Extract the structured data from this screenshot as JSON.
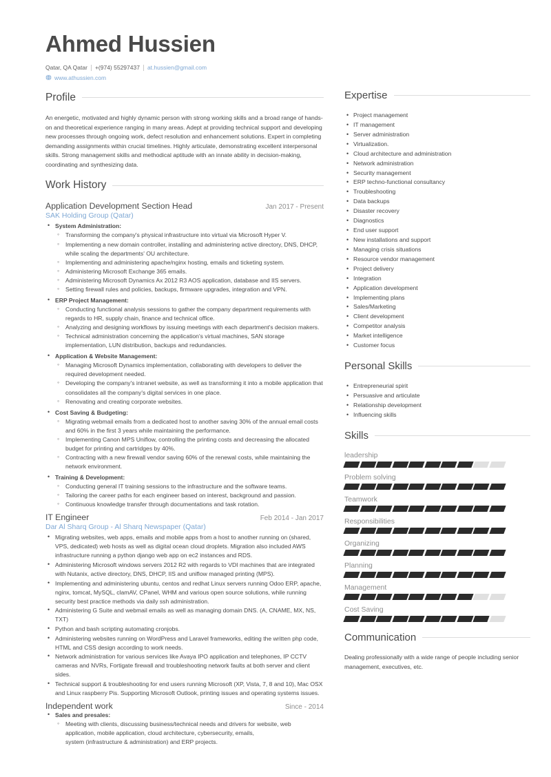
{
  "header": {
    "name": "Ahmed Hussien",
    "location": "Qatar, QA Qatar",
    "phone": "+(974) 55297437",
    "email": "at.hussien@gmail.com",
    "website": "www.athussien.com",
    "globe_icon": "globe-icon"
  },
  "sections": {
    "profile": "Profile",
    "work_history": "Work History",
    "expertise": "Expertise",
    "personal_skills": "Personal Skills",
    "skills": "Skills",
    "communication": "Communication"
  },
  "profile": {
    "text": "An energetic, motivated and highly dynamic person with strong working skills and a broad range of hands-on and theoretical experience ranging in many areas. Adept at providing technical support and developing new processes through ongoing work, defect resolution and enhancement solutions. Expert in completing demanding assignments within crucial timelines. Highly articulate, demonstrating excellent interpersonal skills. Strong management skills and methodical aptitude with an innate ability in decision-making, coordinating and synthesizing data."
  },
  "jobs": [
    {
      "title": "Application Development Section Head",
      "date": "Jan 2017 - Present",
      "company": "SAK Holding Group (Qatar)",
      "groups": [
        {
          "heading": "System Administration:",
          "items": [
            "Transforming the company's physical infrastructure into virtual via Microsoft Hyper V.",
            "Implementing a new domain controller, installing and administering active directory, DNS, DHCP, while  scaling the departments' OU architecture.",
            "Implementing and administering apache/nginx hosting, emails and ticketing system.",
            "Administering Microsoft Exchange 365 emails.",
            "Administering Microsoft Dynamics Ax 2012 R3 AOS application, database and IIS servers.",
            "Setting firewall rules and policies, backups, firmware upgrades, integration and VPN."
          ]
        },
        {
          "heading": "ERP Project Management:",
          "items": [
            "Conducting functional analysis sessions to gather the company department requirements with regards to HR, supply chain, finance and technical office.",
            "Analyzing and designing workflows by issuing meetings with each department's decision makers.",
            "Technical administration concerning the application's virtual machines, SAN storage implementation, LUN distribution, backups and redundancies."
          ]
        },
        {
          "heading": "Application & Website Management:",
          "items": [
            "Managing Microsoft Dynamics implementation, collaborating with developers to deliver the required development needed.",
            "Developing the company's intranet website, as well as transforming it into a mobile application that consolidates all the company's digital services in  one place.",
            "Renovating and creating corporate websites."
          ]
        },
        {
          "heading": "Cost Saving & Budgeting:",
          "items": [
            "Migrating webmail emails from a dedicated host to another saving 30% of the annual email costs and 60% in the first 3 years while maintaining the performance.",
            "Implementing Canon MPS Uniflow, controlling the printing costs and decreasing the allocated budget for printing and cartridges by 40%.",
            "Contracting with a new firewall vendor saving 60% of  the renewal costs, while maintaining the network environment."
          ]
        },
        {
          "heading": "Training & Development:",
          "items": [
            "Conducting general IT training sessions to the infrastructure and the software teams.",
            "Tailoring the career paths for each engineer based on interest, background and passion.",
            "Continuous knowledge transfer through documentations and task rotation."
          ]
        }
      ]
    },
    {
      "title": "IT Engineer",
      "date": "Feb 2014 - Jan 2017",
      "company": "Dar Al Sharq Group - Al Sharq Newspaper (Qatar)",
      "bullets": [
        "Migrating websites, web apps, emails and mobile apps from a host to another running on (shared, VPS, dedicated) web hosts as well as digital ocean cloud droplets. Migration also included AWS infrastructure running a python django web app on ec2 instances and RDS.",
        "Administering Microsoft windows servers 2012 R2 with regards to VDI machines that are integrated with Nutanix, active directory, DNS, DHCP, IIS and uniflow managed printing (MPS).",
        " Implementing and administering ubuntu, centos and redhat Linux servers running Odoo ERP, apache, nginx, tomcat, MySQL, clamAV, CPanel, WHM and various open source solutions, while running security best practice methods via daily ssh administration.",
        "Administering G Suite and webmail emails as well as managing domain DNS. (A, CNAME, MX, NS, TXT)",
        "Python and bash scripting automating cronjobs.",
        "Administering websites running on WordPress and Laravel frameworks, editing the written php code, HTML and CSS design according to work needs.",
        "Network administration for various services like Avaya IPO application and telephones, IP CCTV cameras and NVRs, Fortigate firewall and troubleshooting network faults at both server and client sides.",
        "Technical support & troubleshooting for end users running Microsoft (XP, Vista, 7, 8 and 10), Mac OSX and Linux raspberry Pis. Supporting Microsoft Outlook, printing issues and operating systems issues."
      ]
    },
    {
      "title": "Independent work",
      "date": "Since - 2014",
      "company": "",
      "groups": [
        {
          "heading": "Sales and presales:",
          "items": [
            "Meeting with clients, discussing business/technical needs and drivers for website, web\napplication, mobile application, cloud architecture, cybersecurity, emails,\nsystem (infrastructure & administration) and ERP projects."
          ]
        }
      ]
    }
  ],
  "expertise": [
    "Project management",
    "IT management",
    "Server administration",
    "Virtualization.",
    "Cloud architecture and administration",
    "Network administration",
    "Security management",
    "ERP techno-functional consultancy",
    "Troubleshooting",
    "Data backups",
    "Disaster recovery",
    "Diagnostics",
    "End user support",
    "New installations and support",
    "Managing crisis situations",
    "Resource vendor management",
    "Project delivery",
    "Integration",
    "Application development",
    "Implementing plans",
    "Sales/Marketing",
    "Client development",
    "Competitor analysis",
    "Market intelligence",
    "Customer focus"
  ],
  "personal_skills": [
    "Entrepreneurial spirit",
    "Persuasive and articulate",
    "Relationship development",
    "Influencing skills"
  ],
  "skills": [
    {
      "name": "leadership",
      "level": 8,
      "max": 10
    },
    {
      "name": "Problem solving",
      "level": 10,
      "max": 10
    },
    {
      "name": "Teamwork",
      "level": 10,
      "max": 10
    },
    {
      "name": "Responsibilities",
      "level": 10,
      "max": 10
    },
    {
      "name": "Organizing",
      "level": 10,
      "max": 10
    },
    {
      "name": "Planning",
      "level": 10,
      "max": 10
    },
    {
      "name": "Management",
      "level": 8,
      "max": 10
    },
    {
      "name": "Cost Saving",
      "level": 9,
      "max": 10
    }
  ],
  "communication": {
    "text": "Dealing professionally with a wide range of people including senior management, executives, etc."
  },
  "colors": {
    "accent": "#7fa8d4",
    "text": "#4a4a4a",
    "muted": "#8d8d8d",
    "bar_on": "#2b2b2b",
    "bar_off": "#e0e0e0"
  }
}
